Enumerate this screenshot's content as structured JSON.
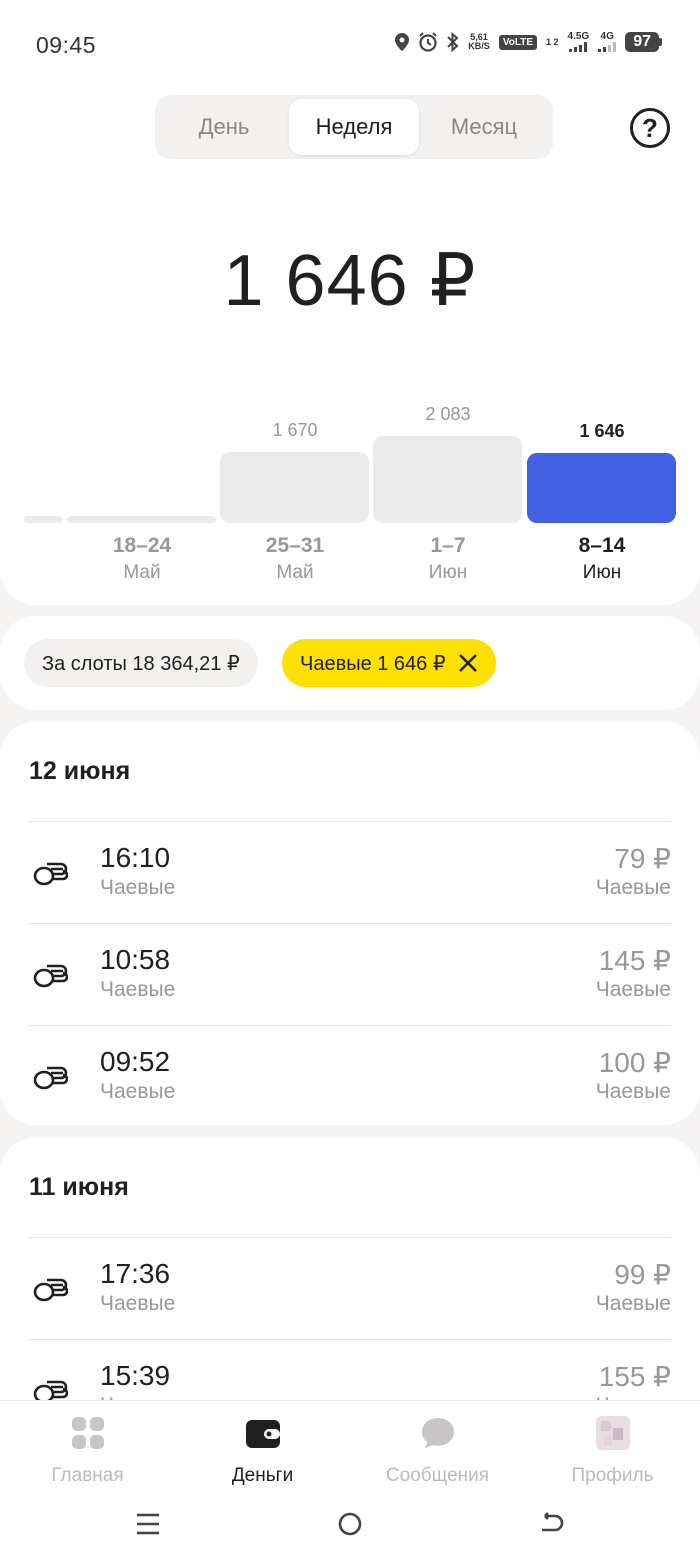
{
  "status": {
    "time": "09:45",
    "net_speed_top": "5,61",
    "net_speed_unit": "KB/S",
    "volte": "VoLTE",
    "sim": "1 2",
    "gen1": "4.5G",
    "gen2": "4G",
    "battery": "97"
  },
  "period_tabs": {
    "day": "День",
    "week": "Неделя",
    "month": "Месяц",
    "selected": "week"
  },
  "help_label": "?",
  "total_amount": "1 646 ₽",
  "chart_data": {
    "type": "bar",
    "categories": [
      "",
      "18–24 Май",
      "25–31 Май",
      "1–7 Июн",
      "8–14 Июн"
    ],
    "values": [
      0,
      0,
      1670,
      2083,
      1646
    ],
    "value_labels": [
      "",
      "",
      "1 670",
      "2 083",
      "1 646"
    ],
    "range_labels": [
      "",
      "18–24",
      "25–31",
      "1–7",
      "8–14"
    ],
    "month_labels": [
      "",
      "Май",
      "Май",
      "Июн",
      "Июн"
    ],
    "selected_index": 4,
    "active_color": "#4260e2",
    "inactive_color": "#ebebeb",
    "ylim": [
      0,
      2083
    ]
  },
  "filters": {
    "slots_label": "За слоты 18 364,21 ₽",
    "tips_label": "Чаевые 1 646 ₽",
    "close_icon": "close-icon"
  },
  "groups": [
    {
      "title": "12 июня",
      "rows": [
        {
          "time": "16:10",
          "type": "Чаевые",
          "amount": "79 ₽",
          "category": "Чаевые"
        },
        {
          "time": "10:58",
          "type": "Чаевые",
          "amount": "145 ₽",
          "category": "Чаевые"
        },
        {
          "time": "09:52",
          "type": "Чаевые",
          "amount": "100 ₽",
          "category": "Чаевые"
        }
      ]
    },
    {
      "title": "11 июня",
      "rows": [
        {
          "time": "17:36",
          "type": "Чаевые",
          "amount": "99 ₽",
          "category": "Чаевые"
        },
        {
          "time": "15:39",
          "type": "Чаевые",
          "amount": "155 ₽",
          "category": "Чаевые"
        }
      ]
    }
  ],
  "tabbar": {
    "home": "Главная",
    "money": "Деньги",
    "messages": "Сообщения",
    "profile": "Профиль",
    "active": "money"
  },
  "colors": {
    "accent_blue": "#4260e2",
    "chip_yellow": "#fce000"
  }
}
